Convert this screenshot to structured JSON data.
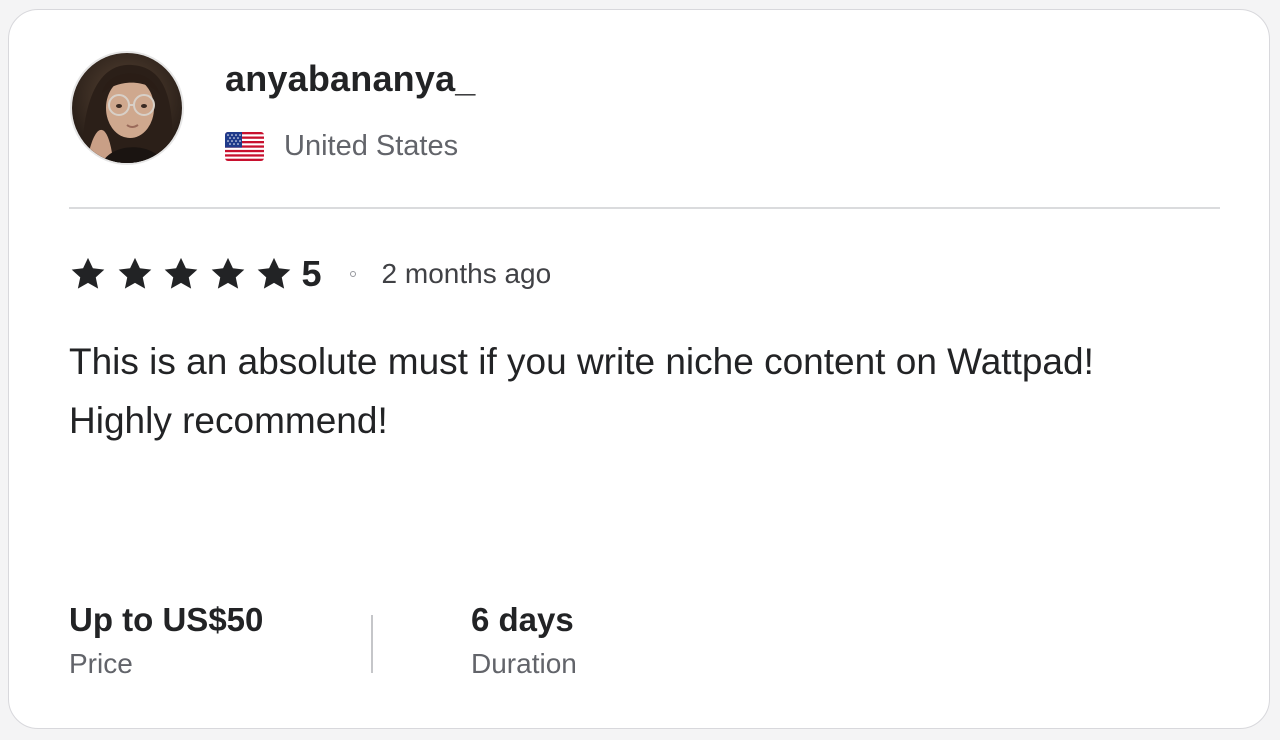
{
  "reviewer": {
    "username": "anyabananya_",
    "country": "United States",
    "avatar_icon": "user-avatar-photo",
    "flag_icon": "us-flag-icon"
  },
  "review": {
    "rating": "5",
    "star_count": 5,
    "time_ago": "2 months ago",
    "text": "This is an absolute must if you write niche content on Wattpad! Highly recommend!"
  },
  "stats": {
    "price_value": "Up to US$50",
    "price_label": "Price",
    "duration_value": "6 days",
    "duration_label": "Duration"
  },
  "colors": {
    "star": "#222325",
    "text_primary": "#222325",
    "text_secondary": "#62646a",
    "border": "#d8d8dc"
  }
}
